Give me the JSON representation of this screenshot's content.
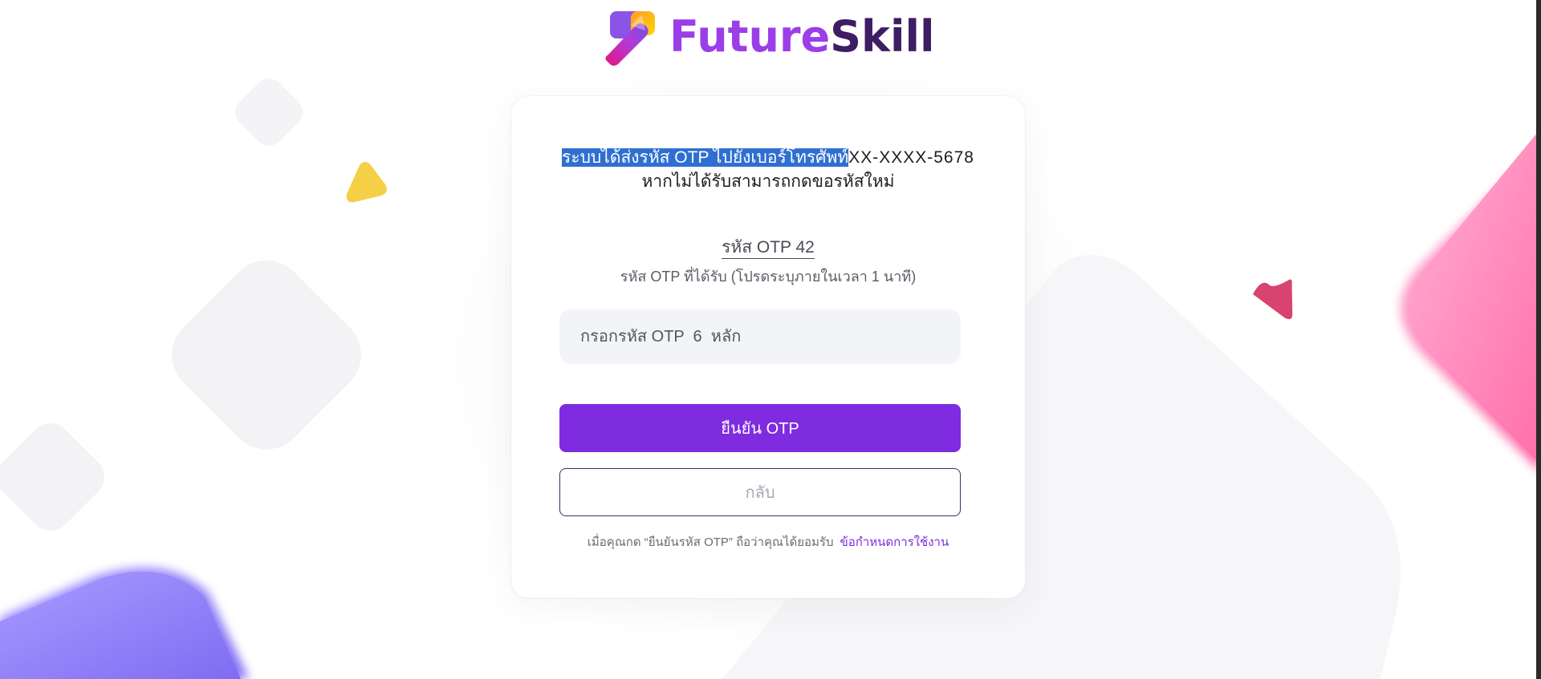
{
  "brand": {
    "name_part1": "Future",
    "name_part2": "Skill",
    "color_primary": "#9b3ee8",
    "color_dark": "#3d1d63"
  },
  "otp_page": {
    "notice_highlighted": "ระบบได้ส่งรหัส OTP ไปยังเบอร์โทรศัพท์",
    "notice_phone": "XX-XXXX-5678",
    "notice_line2": "หากไม่ได้รับสามารถกดขอรหัสใหม่",
    "otp_label": "รหัส OTP 42",
    "otp_hint": "รหัส OTP ที่ได้รับ (โปรดระบุภายในเวลา 1 นาที)",
    "otp_input_placeholder": "กรอกรหัส OTP  6  หลัก",
    "otp_input_value": "",
    "confirm_button": "ยืนยัน OTP",
    "back_button": "กลับ",
    "terms_text": "เมื่อคุณกด “ยืนยันรหัส OTP” ถือว่าคุณได้ยอมรับ",
    "terms_link": "ข้อกำหนดการใช้งาน"
  },
  "colors": {
    "accent": "#7f2be0",
    "selection_highlight": "#2f6fd1",
    "input_background": "#f3f4f8"
  }
}
